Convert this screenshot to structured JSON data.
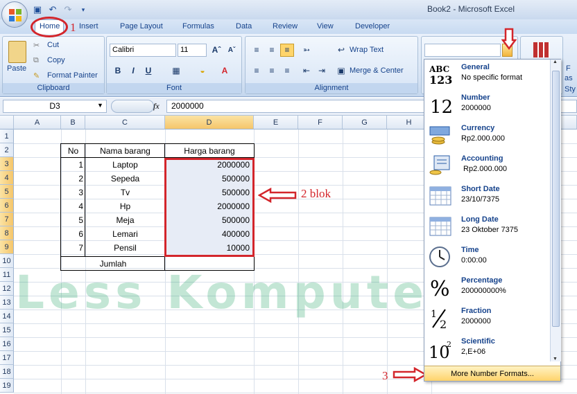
{
  "window": {
    "title": "Book2 - Microsoft Excel"
  },
  "tabs": [
    "Home",
    "Insert",
    "Page Layout",
    "Formulas",
    "Data",
    "Review",
    "View",
    "Developer"
  ],
  "clipboard": {
    "paste": "Paste",
    "cut": "Cut",
    "copy": "Copy",
    "format_painter": "Format Painter",
    "label": "Clipboard"
  },
  "font": {
    "name": "Calibri",
    "size": "11",
    "label": "Font",
    "bold": "B",
    "italic": "I",
    "underline": "U"
  },
  "alignment": {
    "wrap": "Wrap Text",
    "merge": "Merge & Center",
    "label": "Alignment"
  },
  "ribbon_extra": {
    "sty": "Sty",
    "f": "F",
    "as": "as"
  },
  "formula": {
    "namebox": "D3",
    "fx": "fx",
    "value": "2000000"
  },
  "columns": [
    "A",
    "B",
    "C",
    "D",
    "E",
    "F",
    "G",
    "H"
  ],
  "rows": [
    "1",
    "2",
    "3",
    "4",
    "5",
    "6",
    "7",
    "8",
    "9",
    "10",
    "11",
    "12",
    "13",
    "14",
    "15",
    "16",
    "17",
    "18",
    "19"
  ],
  "table": {
    "headers": [
      "No",
      "Nama barang",
      "Harga barang"
    ],
    "rows": [
      [
        "1",
        "Laptop",
        "2000000"
      ],
      [
        "2",
        "Sepeda",
        "500000"
      ],
      [
        "3",
        "Tv",
        "500000"
      ],
      [
        "4",
        "Hp",
        "2000000"
      ],
      [
        "5",
        "Meja",
        "500000"
      ],
      [
        "6",
        "Lemari",
        "400000"
      ],
      [
        "7",
        "Pensil",
        "10000"
      ]
    ],
    "total_label": "Jumlah"
  },
  "number_formats": [
    {
      "name": "General",
      "value": "No specific format",
      "icon": "abc-123-icon"
    },
    {
      "name": "Number",
      "value": "2000000",
      "icon": "number-12-icon"
    },
    {
      "name": "Currency",
      "value": "Rp2.000.000",
      "icon": "currency-icon"
    },
    {
      "name": "Accounting",
      "value": " Rp2.000.000",
      "icon": "accounting-icon"
    },
    {
      "name": "Short Date",
      "value": "23/10/7375",
      "icon": "calendar-icon"
    },
    {
      "name": "Long Date",
      "value": "23 Oktober 7375",
      "icon": "calendar-icon"
    },
    {
      "name": "Time",
      "value": "0:00:00",
      "icon": "clock-icon"
    },
    {
      "name": "Percentage",
      "value": "200000000%",
      "icon": "percent-icon"
    },
    {
      "name": "Fraction",
      "value": "2000000",
      "icon": "fraction-icon"
    },
    {
      "name": "Scientific",
      "value": "2,E+06",
      "icon": "scientific-icon"
    }
  ],
  "more_formats": "More Number Formats...",
  "annotations": {
    "step1": "1",
    "step2": "2 blok",
    "step3": "3"
  },
  "watermark": "Less Komputer",
  "colors": {
    "annotation": "#d3252b",
    "ribbon_text": "#15428b",
    "selection": "#e7ecf6"
  }
}
